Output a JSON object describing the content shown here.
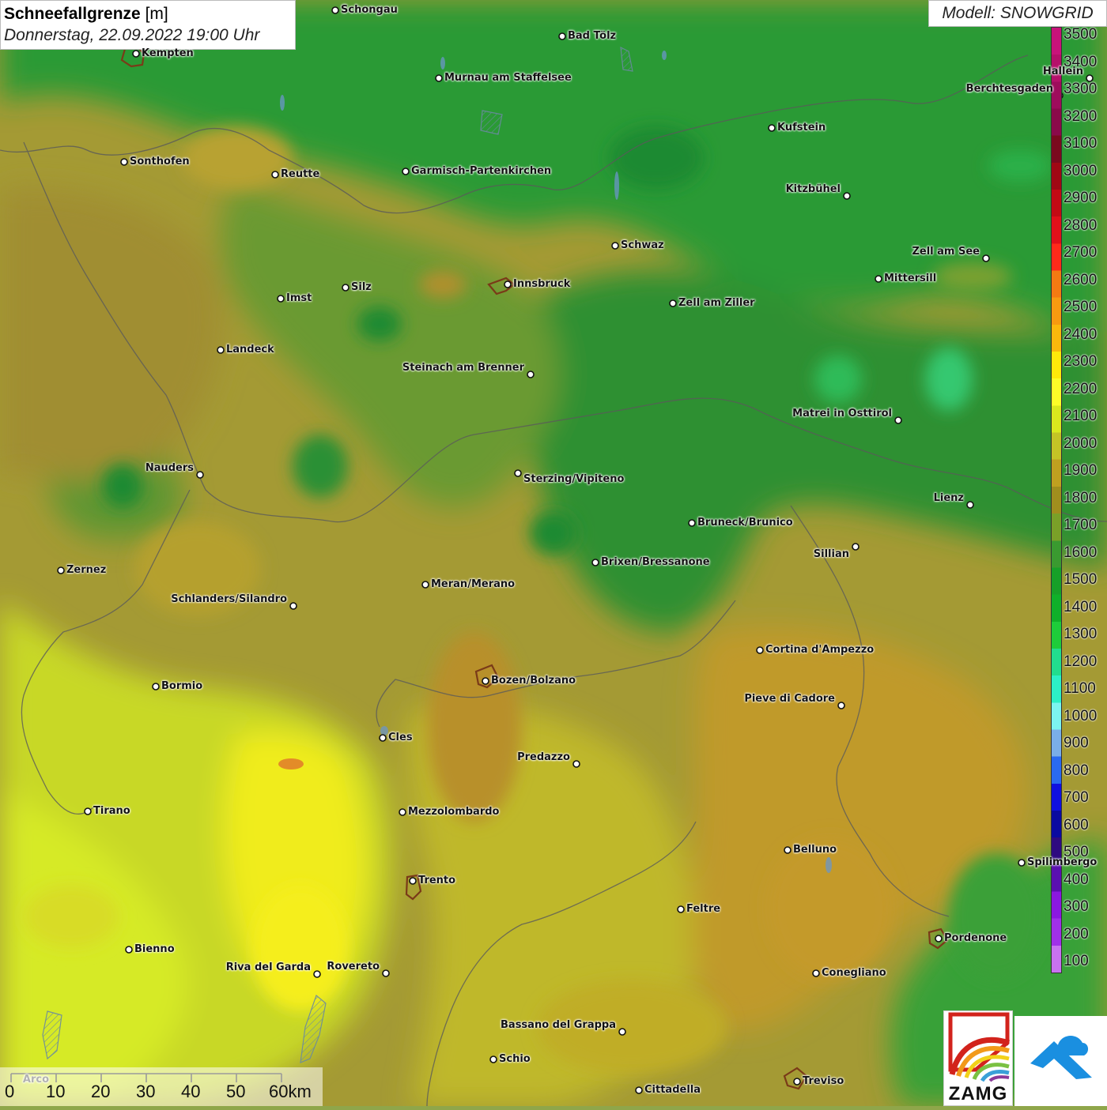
{
  "header": {
    "title_bold": "Schneefallgrenze",
    "title_unit": "[m]",
    "datetime": "Donnerstag, 22.09.2022 19:00 Uhr"
  },
  "model": {
    "label": "Modell: SNOWGRID"
  },
  "legend": {
    "labels": [
      "3500",
      "3400",
      "3300",
      "3200",
      "3100",
      "3000",
      "2900",
      "2800",
      "2700",
      "2600",
      "2500",
      "2400",
      "2300",
      "2200",
      "2100",
      "2000",
      "1900",
      "1800",
      "1700",
      "1600",
      "1500",
      "1400",
      "1300",
      "1200",
      "1100",
      "1000",
      "900",
      "800",
      "700",
      "600",
      "500",
      "400",
      "300",
      "200",
      "100"
    ],
    "colors": [
      "#c8137a",
      "#b5106a",
      "#9e0c5c",
      "#8a0a4a",
      "#7a0a1e",
      "#a00814",
      "#c30a14",
      "#e0101a",
      "#ff2a1a",
      "#f47a12",
      "#f79a10",
      "#fbb80c",
      "#ffe90a",
      "#fdfd28",
      "#d9e81e",
      "#c4c426",
      "#c0a020",
      "#a08e1e",
      "#7aa028",
      "#3a9a30",
      "#17a028",
      "#10b02a",
      "#1ecc3a",
      "#22dd8e",
      "#2cf0c6",
      "#7cf4f0",
      "#7aaee8",
      "#2a6af0",
      "#1010e0",
      "#0a0aa0",
      "#2e0a80",
      "#5a10b0",
      "#8a18e0",
      "#a030e8",
      "#c872f0"
    ]
  },
  "cities": [
    {
      "name": "Schongau"
    },
    {
      "name": "Bad Tölz"
    },
    {
      "name": "Kempten"
    },
    {
      "name": "Murnau am Staffelsee"
    },
    {
      "name": "Berchtesgaden"
    },
    {
      "name": "Hallein"
    },
    {
      "name": "Kufstein"
    },
    {
      "name": "Sonthofen"
    },
    {
      "name": "Reutte"
    },
    {
      "name": "Garmisch-Partenkirchen"
    },
    {
      "name": "Kitzbühel"
    },
    {
      "name": "Schwaz"
    },
    {
      "name": "Zell am See"
    },
    {
      "name": "Mittersill"
    },
    {
      "name": "Innsbruck"
    },
    {
      "name": "Imst"
    },
    {
      "name": "Silz"
    },
    {
      "name": "Zell am Ziller"
    },
    {
      "name": "Landeck"
    },
    {
      "name": "Steinach am Brenner"
    },
    {
      "name": "Matrei in Osttirol"
    },
    {
      "name": "Nauders"
    },
    {
      "name": "Sterzing/Vipiteno"
    },
    {
      "name": "Lienz"
    },
    {
      "name": "Bruneck/Brunico"
    },
    {
      "name": "Sillian"
    },
    {
      "name": "Brixen/Bressanone"
    },
    {
      "name": "Zernez"
    },
    {
      "name": "Meran/Merano"
    },
    {
      "name": "Schlanders/Silandro"
    },
    {
      "name": "Cortina d'Ampezzo"
    },
    {
      "name": "Bozen/Bolzano"
    },
    {
      "name": "Bormio"
    },
    {
      "name": "Pieve di Cadore"
    },
    {
      "name": "Cles"
    },
    {
      "name": "Predazzo"
    },
    {
      "name": "Tirano"
    },
    {
      "name": "Mezzolombardo"
    },
    {
      "name": "Belluno"
    },
    {
      "name": "Spilimbergo"
    },
    {
      "name": "Trento"
    },
    {
      "name": "Feltre"
    },
    {
      "name": "Pordenone"
    },
    {
      "name": "Bienno"
    },
    {
      "name": "Riva del Garda"
    },
    {
      "name": "Rovereto"
    },
    {
      "name": "Conegliano"
    },
    {
      "name": "Bassano del Grappa"
    },
    {
      "name": "Schio"
    },
    {
      "name": "Treviso"
    },
    {
      "name": "Cittadella"
    },
    {
      "name": "Arco"
    }
  ],
  "scale": {
    "labels": [
      "0",
      "10",
      "20",
      "30",
      "40",
      "50",
      "60km"
    ]
  },
  "logo": {
    "text": "ZAMG"
  }
}
